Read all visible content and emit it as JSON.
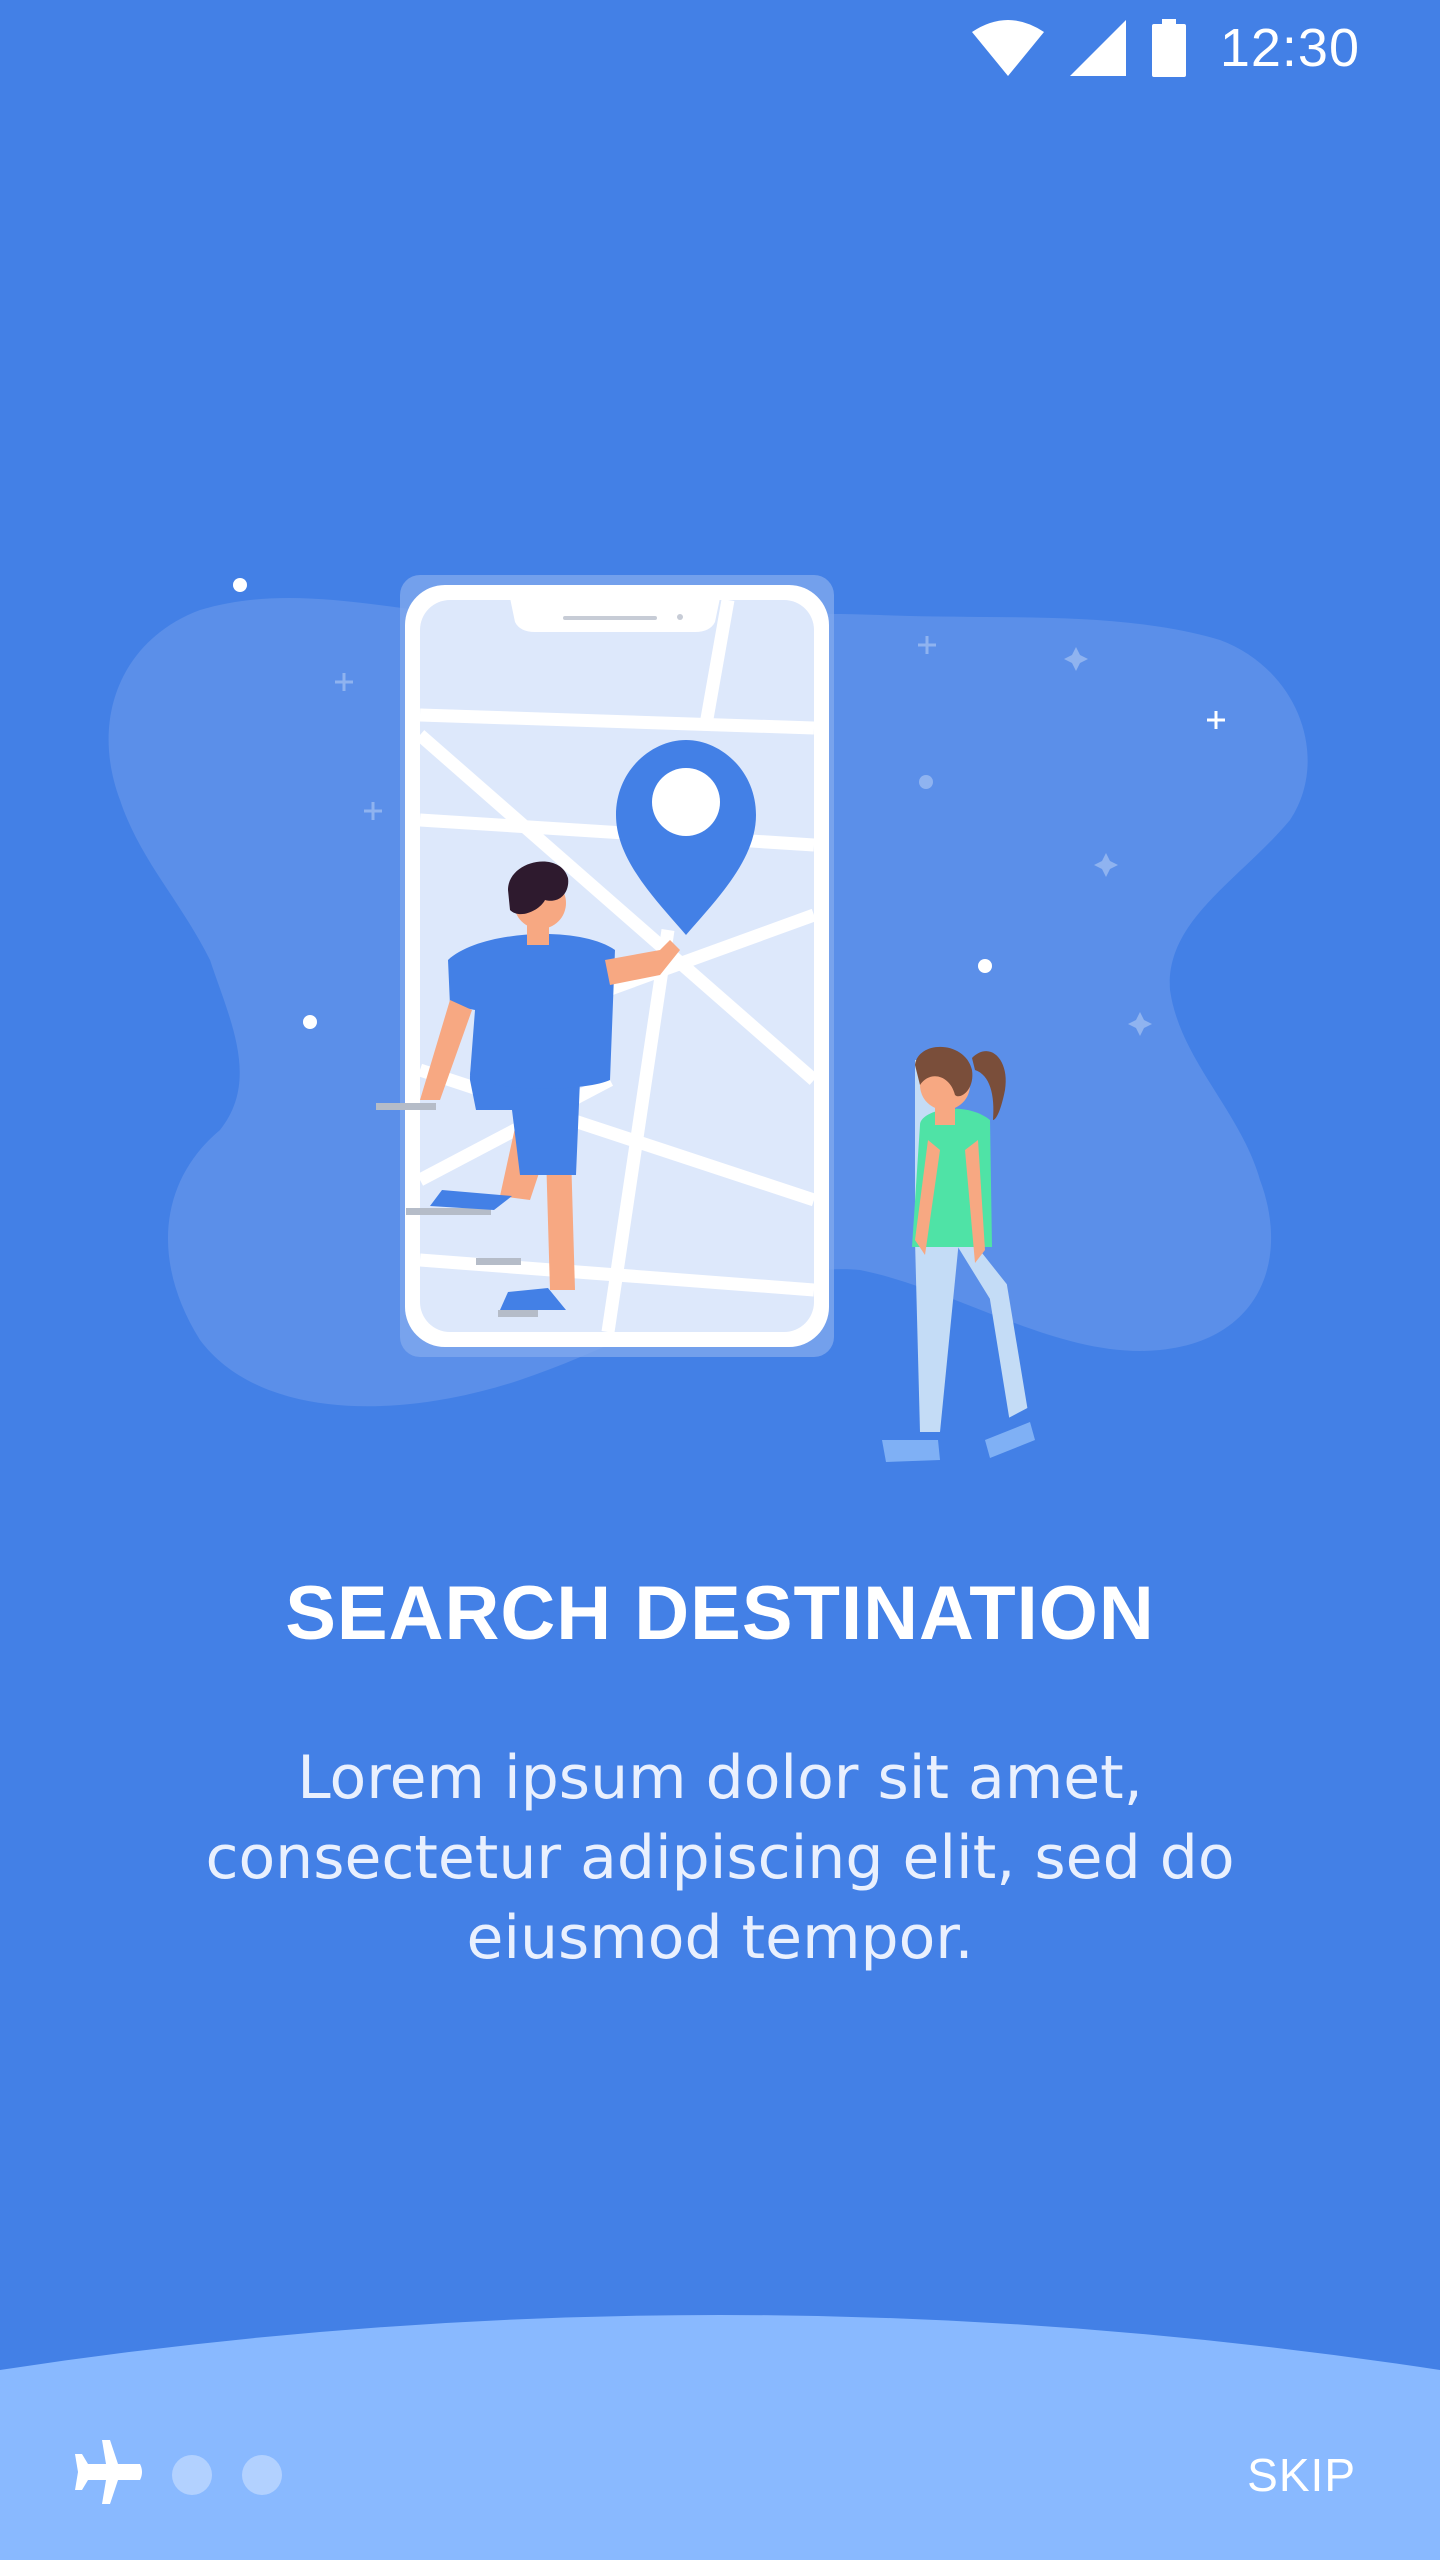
{
  "status_bar": {
    "time": "12:30",
    "icons": [
      "wifi-icon",
      "cellular-signal-icon",
      "battery-icon"
    ]
  },
  "onboarding": {
    "title": "SEARCH DESTINATION",
    "description": "Lorem ipsum dolor sit amet, consectetur adipiscing elit, sed do eiusmod tempor."
  },
  "footer": {
    "skip_label": "SKIP",
    "page_indicator": {
      "current_page": 1,
      "total_pages": 3,
      "active_icon": "airplane-icon"
    }
  },
  "colors": {
    "background": "#4380E6",
    "footer_background": "#89B9FF",
    "accent_green": "#4FE3A6"
  }
}
